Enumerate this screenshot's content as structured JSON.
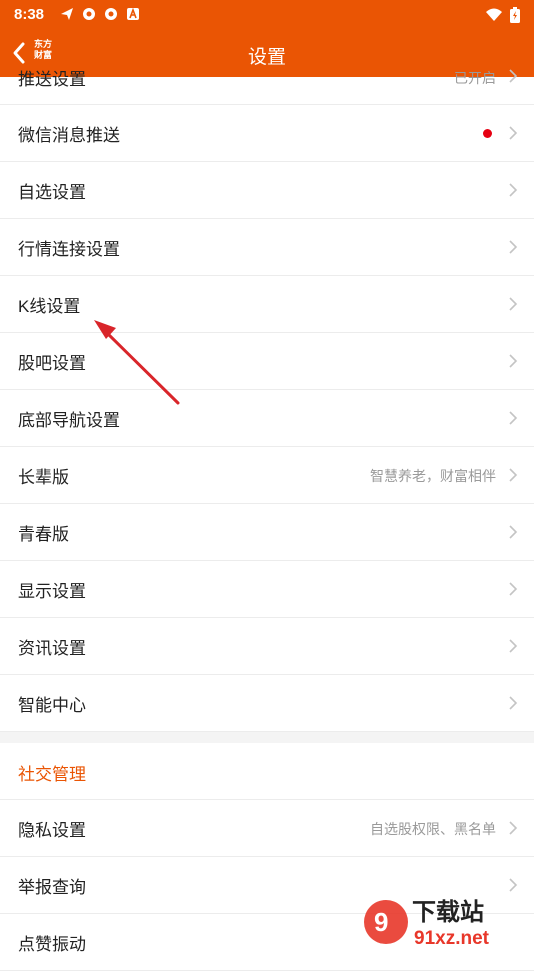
{
  "status": {
    "time": "8:38"
  },
  "header": {
    "brand_line1": "东方",
    "brand_line2": "财富",
    "title": "设置"
  },
  "rows": [
    {
      "label": "推送设置",
      "sub": "已开启"
    },
    {
      "label": "微信消息推送",
      "sub": ""
    },
    {
      "label": "自选设置",
      "sub": ""
    },
    {
      "label": "行情连接设置",
      "sub": ""
    },
    {
      "label": "K线设置",
      "sub": ""
    },
    {
      "label": "股吧设置",
      "sub": ""
    },
    {
      "label": "底部导航设置",
      "sub": ""
    },
    {
      "label": "长辈版",
      "sub": "智慧养老，财富相伴"
    },
    {
      "label": "青春版",
      "sub": ""
    },
    {
      "label": "显示设置",
      "sub": ""
    },
    {
      "label": "资讯设置",
      "sub": ""
    },
    {
      "label": "智能中心",
      "sub": ""
    }
  ],
  "section": {
    "label": "社交管理"
  },
  "social_rows": [
    {
      "label": "隐私设置",
      "sub": "自选股权限、黑名单"
    },
    {
      "label": "举报查询",
      "sub": ""
    },
    {
      "label": "点赞振动",
      "sub": ""
    }
  ],
  "watermark": {
    "text1": "下载站",
    "text2": "91xz.net"
  },
  "colors": {
    "accent": "#ea5504",
    "red_dot": "#e60012",
    "annotation_arrow": "#d9252a"
  }
}
